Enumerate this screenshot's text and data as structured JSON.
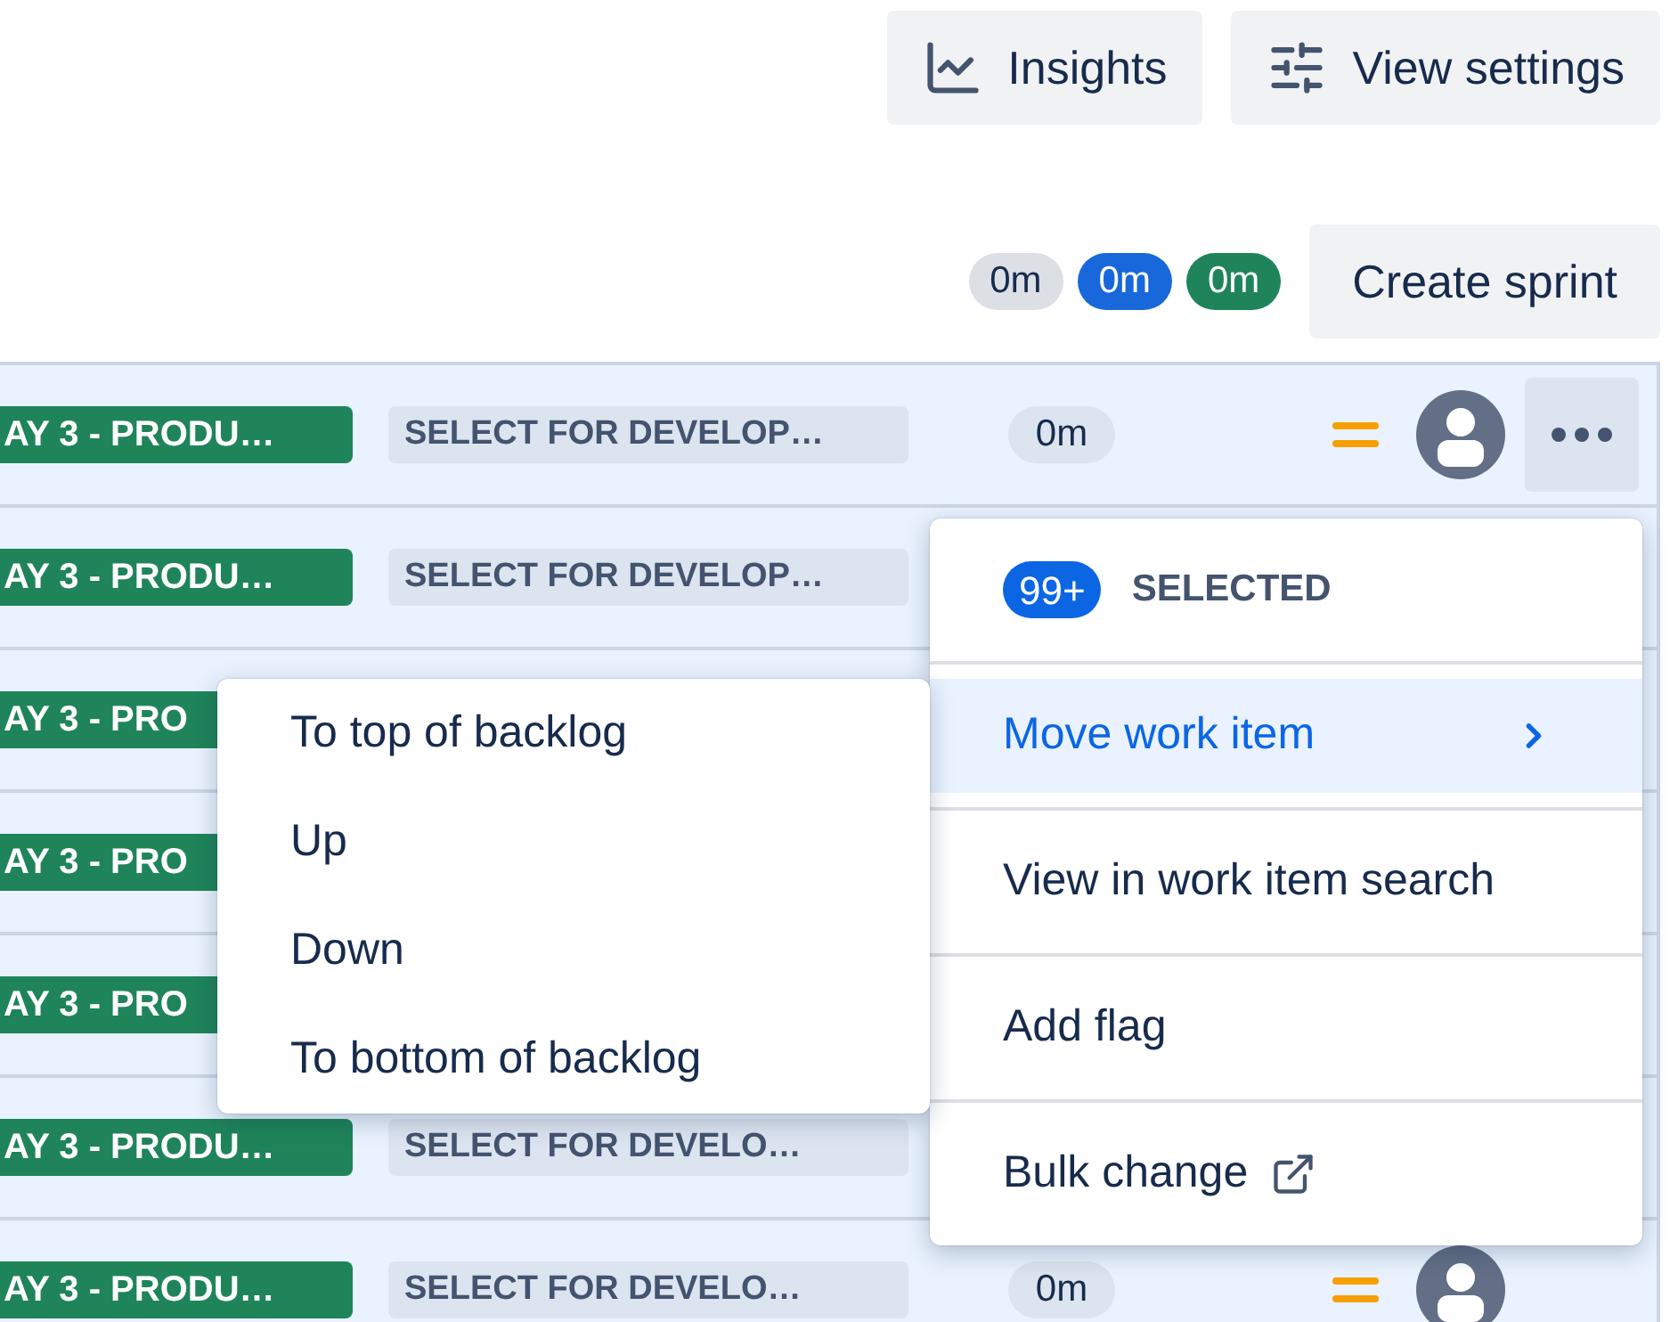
{
  "toolbar": {
    "buttons": [
      {
        "label": "Insights",
        "kind": "chart"
      },
      {
        "label": "View settings",
        "kind": "sliders"
      }
    ]
  },
  "sprint_bar": {
    "estimates": [
      {
        "label": "0m",
        "color": "#dcdfe4"
      },
      {
        "label": "0m",
        "color": "#1868db"
      },
      {
        "label": "0m",
        "color": "#1f845a"
      }
    ],
    "create_button": "Create sprint"
  },
  "rows": [
    {
      "epic": "AY 3 - PRODU…",
      "status": "SELECT FOR DEVELOP…",
      "estimate": "0m",
      "hovered": true
    },
    {
      "epic": "AY 3 - PRODU…",
      "status": "SELECT FOR DEVELOP…"
    },
    {
      "epic": "AY 3 - PRO"
    },
    {
      "epic": "AY 3 - PRO"
    },
    {
      "epic": "AY 3 - PRO"
    },
    {
      "epic": "AY 3 - PRODU…",
      "status": "SELECT FOR DEVELO…"
    },
    {
      "epic": "AY 3 - PRODU…",
      "status": "SELECT FOR DEVELO…",
      "estimate": "0m",
      "hovered": false
    }
  ],
  "menu": {
    "count": "99+",
    "header": "SELECTED",
    "items": [
      {
        "label": "Move work item",
        "kind": "submenu",
        "selected": true
      },
      {
        "label": "View in work item search",
        "kind": "plain",
        "selected": false
      },
      {
        "label": "Add flag",
        "kind": "plain",
        "selected": false
      },
      {
        "label": "Bulk change",
        "kind": "external",
        "selected": false
      }
    ]
  },
  "submenu": {
    "items": [
      {
        "label": "To top of backlog"
      },
      {
        "label": "Up"
      },
      {
        "label": "Down"
      },
      {
        "label": "To bottom of backlog"
      }
    ]
  }
}
